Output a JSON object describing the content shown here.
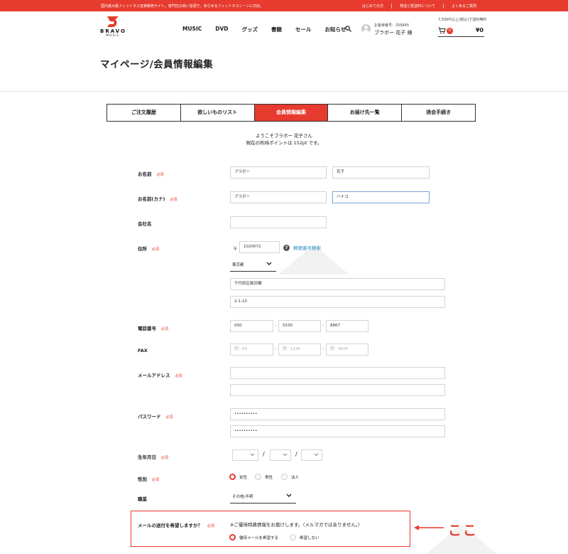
{
  "colors": {
    "accent": "#e63b2e",
    "link": "#2a8fc4"
  },
  "topbar": {
    "message": "国内最大級フィットネス音楽販売サイト。専門性の高い音源で、あらゆるフィットネスシーンに対応。",
    "links": [
      "はじめての方",
      "発送と配送料について",
      "よくあるご質問"
    ]
  },
  "header": {
    "logo_main": "BRAVO",
    "logo_sub": "MUSIC",
    "nav": [
      "MUSIC",
      "DVD",
      "グッズ",
      "書籍",
      "セール",
      "お知らせ"
    ],
    "customer_no": "お客様番号：256845",
    "user_name": "ブラボー 花子 様",
    "free_shipping": "7,500円以上(税込)で送料無料",
    "cart_count": "0",
    "cart_total": "¥0"
  },
  "page_title": "マイページ/会員情報編集",
  "tabs": [
    {
      "label": "ご注文履歴",
      "active": false
    },
    {
      "label": "欲しいものリスト",
      "active": false
    },
    {
      "label": "会員情報編集",
      "active": true
    },
    {
      "label": "お届け先一覧",
      "active": false
    },
    {
      "label": "退会手続き",
      "active": false
    }
  ],
  "welcome": {
    "line1": "ようこそブラボー 花子さん",
    "line2": "現在の所持ポイントは 152pt です。"
  },
  "required_label": "必須",
  "form": {
    "name": {
      "label": "お名前",
      "last": "ブラボー",
      "first": "花子"
    },
    "kana": {
      "label": "お名前(カナ)",
      "last": "ブラボー",
      "first": "ハナコ"
    },
    "company": {
      "label": "会社名",
      "value": ""
    },
    "address": {
      "label": "住所",
      "postal_mark": "〒",
      "zip": "1020072",
      "zip_search": "郵便番号検索",
      "prefecture": "東京都",
      "line1": "千代田区飯田橋",
      "line2": "2-1-10"
    },
    "tel": {
      "label": "電話番号",
      "p1": "050",
      "p2": "5530",
      "p3": "8867"
    },
    "fax": {
      "label": "FAX",
      "ph1": "例：03",
      "ph2": "例：1234",
      "ph3": "例：5678"
    },
    "email": {
      "label": "メールアドレス",
      "value": "",
      "confirm": ""
    },
    "password": {
      "label": "パスワード",
      "value": "••••••••••",
      "confirm": "••••••••••"
    },
    "birthday": {
      "label": "生年月日",
      "sep": "/"
    },
    "gender": {
      "label": "性別",
      "options": [
        "女性",
        "男性",
        "法人"
      ],
      "selected": 0
    },
    "job": {
      "label": "職業",
      "value": "その他/不明"
    },
    "mail": {
      "label": "メールの送付を希望しますか？",
      "note": "※ご優待特典情報をお届けします。（メルマガではありません。）",
      "options": [
        "優待メールを希望する",
        "希望しない"
      ],
      "selected": 0
    }
  },
  "annotation": {
    "text": "ここ"
  }
}
